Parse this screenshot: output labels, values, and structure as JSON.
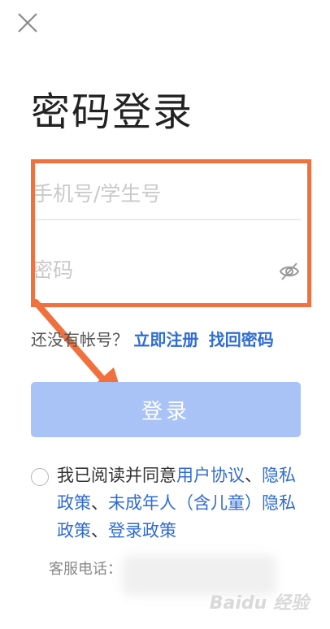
{
  "header": {
    "close_icon": "close-icon"
  },
  "title": "密码登录",
  "form": {
    "phone_placeholder": "手机号/学生号",
    "password_placeholder": "密码",
    "eye_icon": "eye-off-icon"
  },
  "register": {
    "prompt": "还没有帐号？",
    "signup_link": "立即注册",
    "recover_link": "找回密码"
  },
  "login_button": "登录",
  "agreement": {
    "prefix": "我已阅读并同意",
    "user_agreement": "用户协议",
    "sep1": "、",
    "privacy_policy": "隐私政策",
    "sep2": "、",
    "minor_privacy_policy": "未成年人（含儿童）隐私政策",
    "sep3": "、",
    "login_policy": "登录政策"
  },
  "customer_service": {
    "label": "客服电话："
  },
  "watermark": "Baidu 经验",
  "colors": {
    "accent": "#2f6cd3",
    "login_button_bg": "#a9c3f6",
    "annotation": "#f0703e"
  }
}
